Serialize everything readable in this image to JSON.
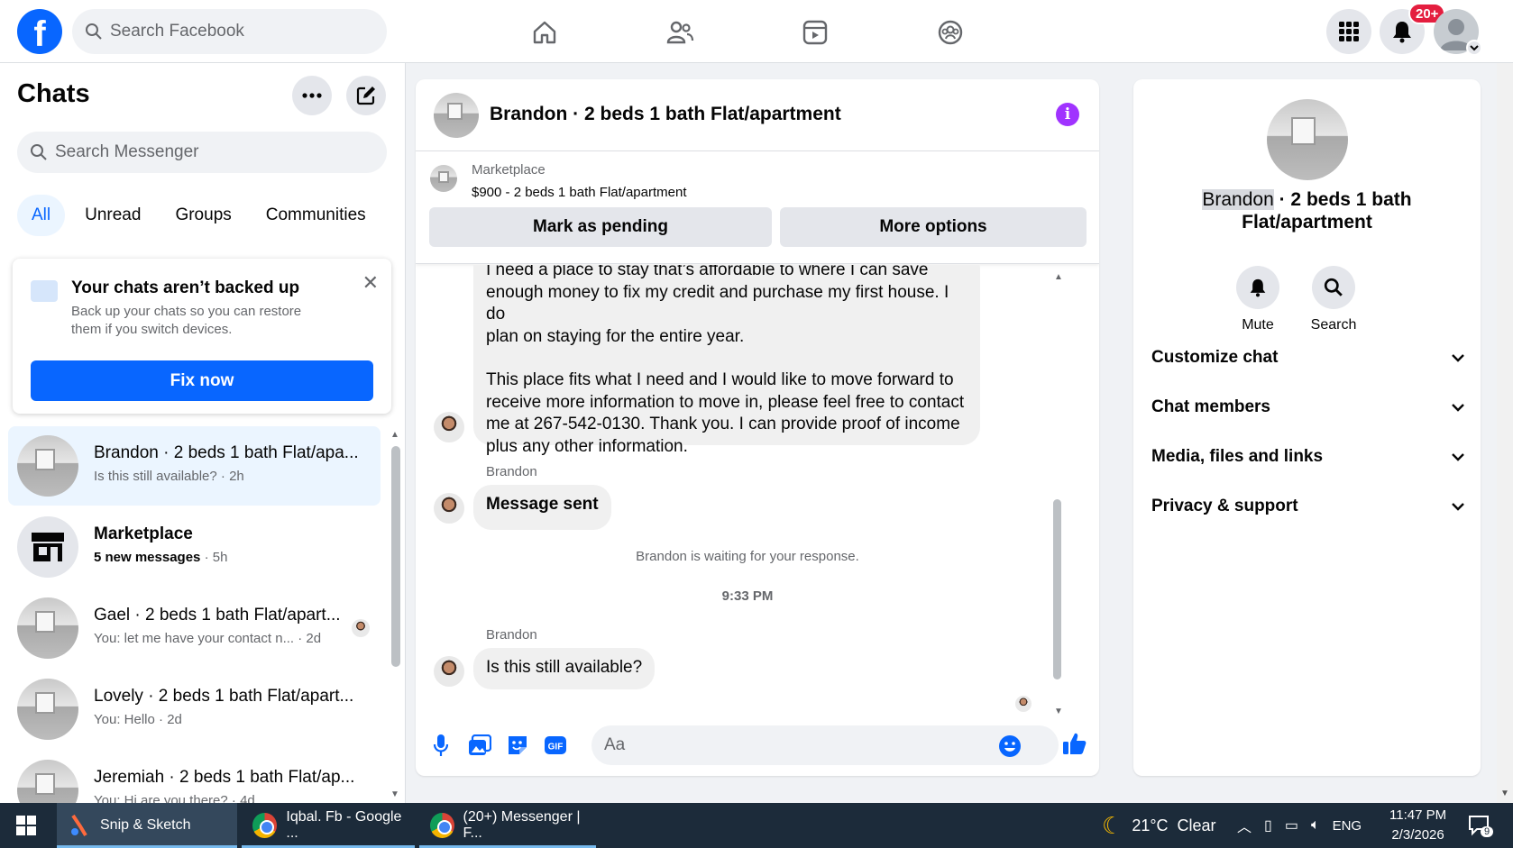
{
  "topbar": {
    "search_placeholder": "Search Facebook",
    "notification_badge": "20+",
    "nav_icons": [
      "home-icon",
      "friends-icon",
      "video-icon",
      "groups-icon"
    ],
    "right_icons": [
      "menu-grid-icon",
      "bell-icon",
      "account-avatar"
    ]
  },
  "sidebar": {
    "title": "Chats",
    "search_placeholder": "Search Messenger",
    "tabs": [
      {
        "label": "All",
        "active": true
      },
      {
        "label": "Unread"
      },
      {
        "label": "Groups"
      },
      {
        "label": "Communities"
      }
    ],
    "backup_card": {
      "title": "Your chats aren’t backed up",
      "desc": "Back up your chats so you can restore them if you switch devices.",
      "button": "Fix now"
    },
    "conversations": [
      {
        "name": "Brandon · 2 beds 1 bath Flat/apa...",
        "snippet": "Is this still available?",
        "time": "2h",
        "active": true
      },
      {
        "name": "Marketplace",
        "snippet": "5 new messages",
        "time": "5h",
        "bold": true
      },
      {
        "name": "Gael · 2 beds 1 bath Flat/apart...",
        "snippet": "You: let me have your contact n...",
        "time": "2d"
      },
      {
        "name": "Lovely · 2 beds 1 bath Flat/apart...",
        "snippet": "You: Hello",
        "time": "2d"
      },
      {
        "name": "Jeremiah · 2 beds 1 bath Flat/ap...",
        "snippet": "You: Hi are you there?",
        "time": "4d"
      }
    ]
  },
  "chat": {
    "title": "Brandon · 2 beds 1 bath Flat/apartment",
    "marketplace_label": "Marketplace",
    "listing": "$900 - 2 beds 1 bath Flat/apartment",
    "mark_pending": "Mark as pending",
    "more_options": "More options",
    "messages": {
      "long_p1_l1": "I need a place to stay that’s affordable to where I can save",
      "long_p1_l2": "enough money to fix my credit and purchase my first house. I do",
      "long_p1_l3": "plan on staying for the entire year.",
      "long_p2_l1": "This place fits what I need and I would like to move forward to",
      "long_p2_l2": "receive more information to move in, please feel free to contact",
      "long_p2_l3": "me at 267-542-0130. Thank you. I can provide proof of income",
      "long_p2_l4": "plus any other information.",
      "sender1": "Brandon",
      "sent": "Message sent",
      "waiting": "Brandon is waiting for your response.",
      "time": "9:33 PM",
      "sender2": "Brandon",
      "last": "Is this still available?"
    },
    "composer_placeholder": "Aa"
  },
  "details": {
    "name_first": "Brandon",
    "name_rest": " · 2 beds 1 bath",
    "name_line2": "Flat/apartment",
    "actions": [
      {
        "label": "Mute"
      },
      {
        "label": "Search"
      }
    ],
    "sections": [
      "Customize chat",
      "Chat members",
      "Media, files and links",
      "Privacy & support"
    ]
  },
  "taskbar": {
    "apps": [
      {
        "label": "Snip & Sketch"
      },
      {
        "label": "Iqbal. Fb - Google ..."
      },
      {
        "label": "(20+) Messenger | F..."
      }
    ],
    "weather": "21°C  Clear",
    "lang": "ENG",
    "time": "11:47 PM",
    "date": "2/3/2026",
    "notif_count": "9"
  },
  "colors": {
    "brand": "#0866ff",
    "badge": "#e41e3f",
    "info": "#a033ff"
  }
}
